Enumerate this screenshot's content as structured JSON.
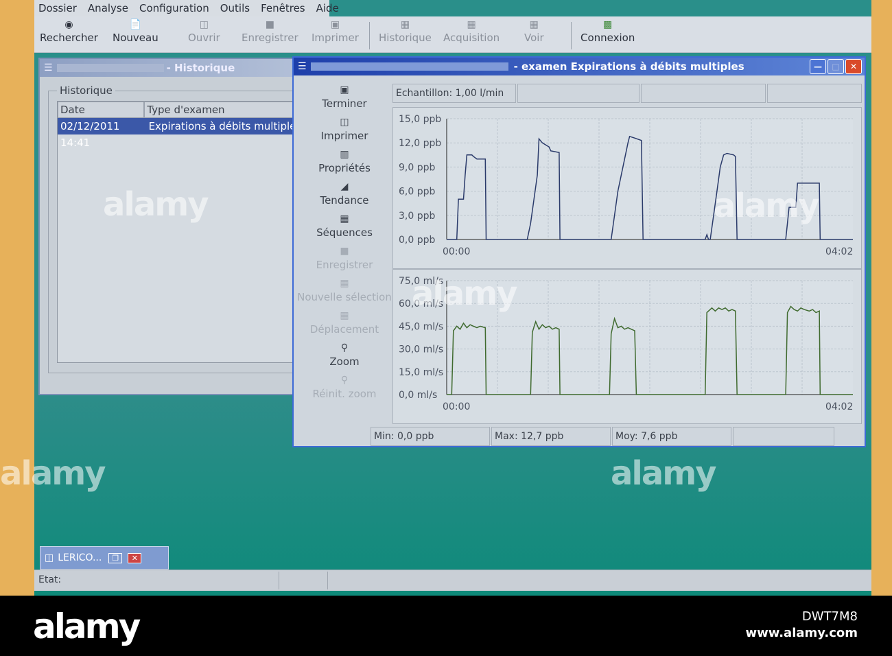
{
  "menu": [
    "Dossier",
    "Analyse",
    "Configuration",
    "Outils",
    "Fenêtres",
    "Aide"
  ],
  "toolbar": {
    "rechercher": "Rechercher",
    "nouveau": "Nouveau",
    "ouvrir": "Ouvrir",
    "enregistrer": "Enregistrer",
    "imprimer": "Imprimer",
    "historique": "Historique",
    "acquisition": "Acquisition",
    "voir": "Voir",
    "connexion": "Connexion"
  },
  "historique_window": {
    "title": "- Historique",
    "group_label": "Historique",
    "columns": [
      "Date",
      "Type d'examen"
    ],
    "rows": [
      [
        "02/12/2011 14:41",
        "Expirations à débits multiples"
      ]
    ]
  },
  "exam_window": {
    "title": "- examen Expirations à débits multiples",
    "sidebar": {
      "terminer": "Terminer",
      "imprimer": "Imprimer",
      "proprietes": "Propriétés",
      "tendance": "Tendance",
      "sequences": "Séquences",
      "enregistrer": "Enregistrer",
      "nouvelle_selection": "Nouvelle sélection",
      "deplacement": "Déplacement",
      "zoom": "Zoom",
      "reinit_zoom": "Réinit. zoom"
    },
    "echantillon": "Echantillon: 1,00 l/min",
    "stats": {
      "min": "Min: 0,0 ppb",
      "max": "Max: 12,7 ppb",
      "moy": "Moy: 7,6 ppb"
    }
  },
  "chart_data": [
    {
      "type": "line",
      "y_ticks": [
        "15,0 ppb",
        "12,0 ppb",
        "9,0 ppb",
        "6,0 ppb",
        "3,0 ppb",
        "0,0 ppb"
      ],
      "x_ticks": [
        "00:00",
        "04:02"
      ],
      "ylim": [
        0,
        15
      ],
      "grid": true,
      "series": [
        {
          "color": "#2a3a6a",
          "points": [
            [
              0,
              0
            ],
            [
              6,
              0
            ],
            [
              7,
              5
            ],
            [
              10,
              5
            ],
            [
              11,
              8
            ],
            [
              12,
              10.5
            ],
            [
              15,
              10.5
            ],
            [
              16,
              10.3
            ],
            [
              18,
              10
            ],
            [
              23,
              10
            ],
            [
              23.5,
              0
            ],
            [
              48,
              0
            ],
            [
              50,
              2
            ],
            [
              52,
              5
            ],
            [
              54,
              8
            ],
            [
              55,
              12.5
            ],
            [
              57,
              12
            ],
            [
              61,
              11.5
            ],
            [
              62,
              11
            ],
            [
              67,
              10.8
            ],
            [
              67.5,
              0
            ],
            [
              98,
              0
            ],
            [
              100,
              3
            ],
            [
              102,
              6
            ],
            [
              104,
              8
            ],
            [
              106,
              10
            ],
            [
              108,
              12
            ],
            [
              109,
              12.8
            ],
            [
              112,
              12.6
            ],
            [
              116,
              12.3
            ],
            [
              117,
              0
            ],
            [
              154,
              0
            ],
            [
              155,
              0.6
            ],
            [
              156,
              0
            ],
            [
              157,
              0
            ],
            [
              159,
              3
            ],
            [
              161,
              6
            ],
            [
              163,
              9
            ],
            [
              165,
              10.5
            ],
            [
              167,
              10.7
            ],
            [
              171,
              10.5
            ],
            [
              172,
              10.3
            ],
            [
              173,
              0
            ],
            [
              202,
              0
            ],
            [
              203,
              2
            ],
            [
              204,
              4
            ],
            [
              208,
              4
            ],
            [
              209,
              7
            ],
            [
              222,
              7
            ],
            [
              222.5,
              0
            ],
            [
              242,
              0
            ]
          ]
        }
      ]
    },
    {
      "type": "line",
      "y_ticks": [
        "75,0 ml/s",
        "60,0 ml/s",
        "45,0 ml/s",
        "30,0 ml/s",
        "15,0 ml/s",
        "0,0 ml/s"
      ],
      "x_ticks": [
        "00:00",
        "04:02"
      ],
      "ylim": [
        0,
        75
      ],
      "grid": true,
      "series": [
        {
          "color": "#3f6a2e",
          "points": [
            [
              0,
              0
            ],
            [
              3,
              0
            ],
            [
              4,
              42
            ],
            [
              6,
              45
            ],
            [
              8,
              43
            ],
            [
              10,
              47
            ],
            [
              12,
              44
            ],
            [
              14,
              46
            ],
            [
              16,
              45
            ],
            [
              18,
              44
            ],
            [
              20,
              45
            ],
            [
              23,
              44
            ],
            [
              23.5,
              0
            ],
            [
              50,
              0
            ],
            [
              51,
              41
            ],
            [
              53,
              48
            ],
            [
              55,
              43
            ],
            [
              57,
              46
            ],
            [
              59,
              44
            ],
            [
              61,
              45
            ],
            [
              63,
              43
            ],
            [
              65,
              44
            ],
            [
              67,
              43
            ],
            [
              67.5,
              0
            ],
            [
              97,
              0
            ],
            [
              98,
              40
            ],
            [
              100,
              50
            ],
            [
              102,
              44
            ],
            [
              104,
              45
            ],
            [
              106,
              43
            ],
            [
              108,
              44
            ],
            [
              110,
              43
            ],
            [
              112,
              42
            ],
            [
              113,
              0
            ],
            [
              154,
              0
            ],
            [
              155,
              54
            ],
            [
              158,
              57
            ],
            [
              160,
              55
            ],
            [
              162,
              57
            ],
            [
              164,
              56
            ],
            [
              166,
              57
            ],
            [
              168,
              55
            ],
            [
              170,
              56
            ],
            [
              172,
              55
            ],
            [
              173,
              0
            ],
            [
              202,
              0
            ],
            [
              203,
              54
            ],
            [
              205,
              58
            ],
            [
              207,
              56
            ],
            [
              209,
              55
            ],
            [
              211,
              57
            ],
            [
              213,
              56
            ],
            [
              216,
              55
            ],
            [
              218,
              56
            ],
            [
              220,
              54
            ],
            [
              222,
              55
            ],
            [
              222.5,
              0
            ],
            [
              242,
              0
            ]
          ]
        }
      ]
    }
  ],
  "taskbar": {
    "label": "LERICO..."
  },
  "status": "Etat:",
  "watermark": "alamy",
  "caption": {
    "logo": "alamy",
    "code": "DWT7M8",
    "url": "www.alamy.com"
  }
}
